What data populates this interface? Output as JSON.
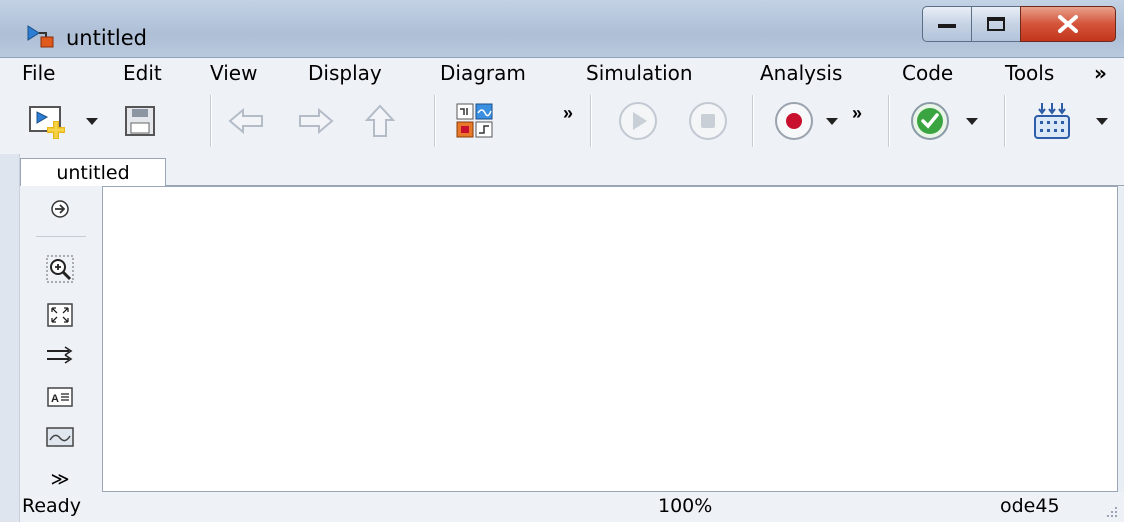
{
  "window": {
    "title": "untitled"
  },
  "menubar": {
    "items": [
      "File",
      "Edit",
      "View",
      "Display",
      "Diagram",
      "Simulation",
      "Analysis",
      "Code",
      "Tools",
      "»"
    ]
  },
  "toolbar": {
    "overflow_1": "»",
    "overflow_2": "»"
  },
  "tabs": [
    {
      "label": "untitled"
    }
  ],
  "palette": {
    "more_label": "≫"
  },
  "status": {
    "state": "Ready",
    "zoom": "100%",
    "solver": "ode45"
  },
  "colors": {
    "record_red": "#c8102e",
    "check_green": "#3aa540",
    "accent_blue": "#2d5da8"
  }
}
